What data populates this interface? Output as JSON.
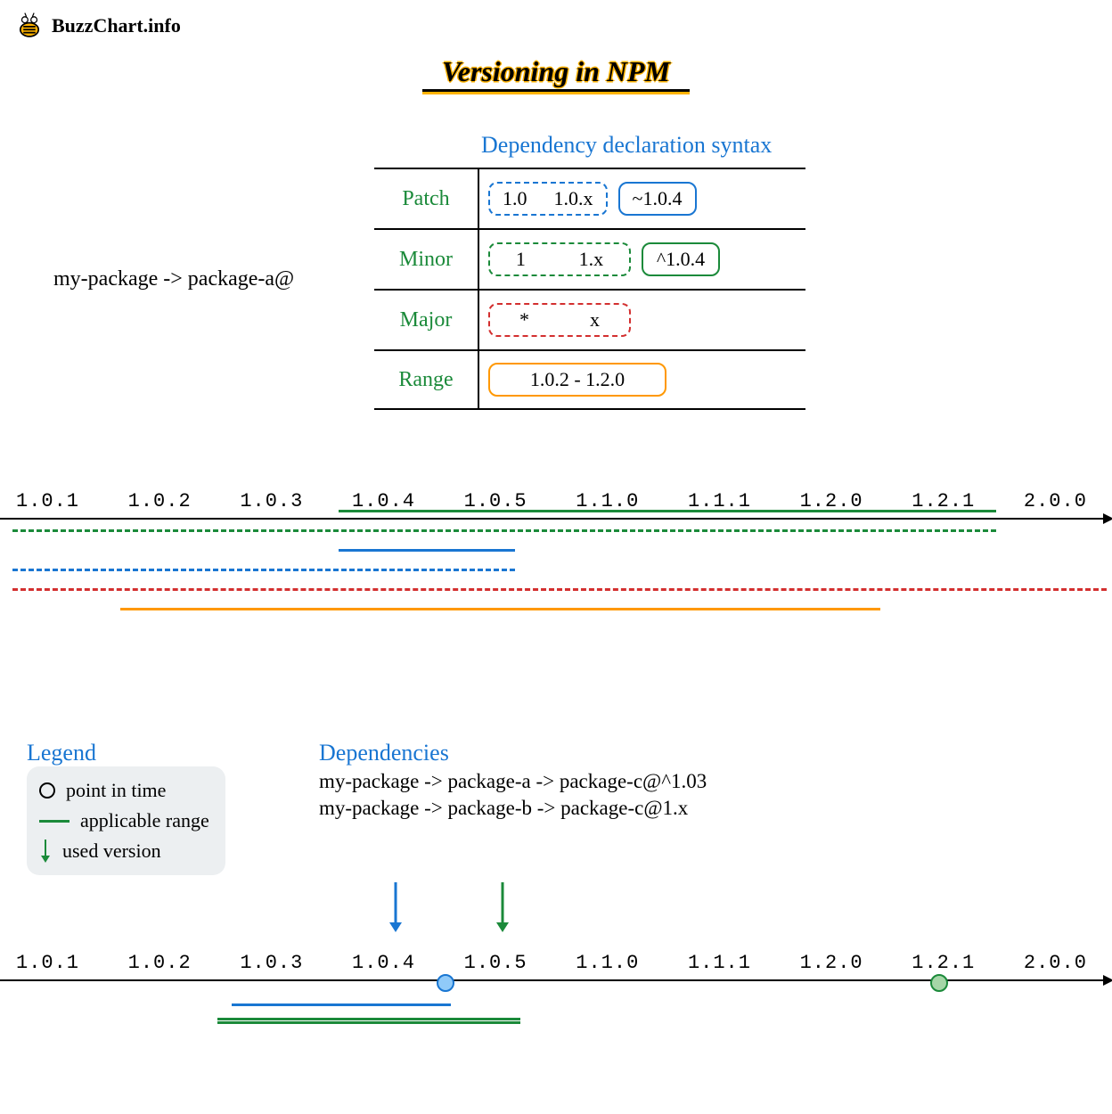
{
  "logo_text": "BuzzChart.info",
  "title": "Versioning in NPM",
  "subtitle": "Dependency declaration syntax",
  "leadin": "my-package -> package-a@",
  "rows": {
    "patch": {
      "label": "Patch",
      "dashed": [
        "1.0",
        "1.0.x"
      ],
      "solid": "~1.0.4"
    },
    "minor": {
      "label": "Minor",
      "dashed": [
        "1",
        "1.x"
      ],
      "solid": "^1.0.4"
    },
    "major": {
      "label": "Major",
      "dashed": [
        "*",
        "x"
      ]
    },
    "range": {
      "label": "Range",
      "solid": "1.0.2 - 1.2.0"
    }
  },
  "timeline": {
    "ticks": [
      "1.0.1",
      "1.0.2",
      "1.0.3",
      "1.0.4",
      "1.0.5",
      "1.1.0",
      "1.1.1",
      "1.2.0",
      "1.2.1",
      "2.0.0"
    ]
  },
  "legend": {
    "title": "Legend",
    "items": {
      "point": "point in time",
      "range": "applicable range",
      "used": "used version"
    }
  },
  "dependencies": {
    "title": "Dependencies",
    "lines": [
      "my-package -> package-a -> package-c@^1.03",
      "my-package -> package-b -> package-c@1.x"
    ]
  },
  "chart_data": {
    "type": "diagram",
    "title": "Versioning in NPM",
    "syntax_table": [
      {
        "level": "Patch",
        "wildcard_forms": [
          "1.0",
          "1.0.x"
        ],
        "operator_form": "~1.0.4"
      },
      {
        "level": "Minor",
        "wildcard_forms": [
          "1",
          "1.x"
        ],
        "operator_form": "^1.0.4"
      },
      {
        "level": "Major",
        "wildcard_forms": [
          "*",
          "x"
        ],
        "operator_form": null
      },
      {
        "level": "Range",
        "wildcard_forms": null,
        "operator_form": "1.0.2 - 1.2.0"
      }
    ],
    "versions_axis": [
      "1.0.1",
      "1.0.2",
      "1.0.3",
      "1.0.4",
      "1.0.5",
      "1.1.0",
      "1.1.1",
      "1.2.0",
      "1.2.1",
      "2.0.0"
    ],
    "applicable_ranges_chart1": [
      {
        "spec": "^1.0.4",
        "style": "green-solid",
        "from": "1.0.4",
        "to": "1.2.1"
      },
      {
        "spec": "1 / 1.x",
        "style": "green-dashed",
        "from": "1.0.1",
        "to": "1.2.1"
      },
      {
        "spec": "~1.0.4",
        "style": "blue-solid",
        "from": "1.0.4",
        "to": "1.0.5"
      },
      {
        "spec": "1.0 / 1.0.x",
        "style": "blue-dashed",
        "from": "1.0.1",
        "to": "1.0.5"
      },
      {
        "spec": "* / x",
        "style": "red-dashed",
        "from": "1.0.1",
        "to": "2.0.0"
      },
      {
        "spec": "1.0.2 - 1.2.0",
        "style": "orange-solid",
        "from": "1.0.2",
        "to": "1.2.0"
      }
    ],
    "resolution_example": {
      "deps": [
        "my-package -> package-a -> package-c@^1.03",
        "my-package -> package-b -> package-c@1.x"
      ],
      "points_in_time": [
        {
          "at_between": [
            "1.0.4",
            "1.0.5"
          ],
          "color": "blue",
          "range_spec": "^1.03",
          "range_from": "1.0.3",
          "range_to_point": true,
          "used_version": "1.0.4"
        },
        {
          "at_between": [
            "1.2.0",
            "1.2.1"
          ],
          "color": "green",
          "range_spec": "1.x",
          "range_from": "1.0.3",
          "range_to": "1.0.5",
          "used_version": "1.0.5"
        }
      ]
    }
  }
}
